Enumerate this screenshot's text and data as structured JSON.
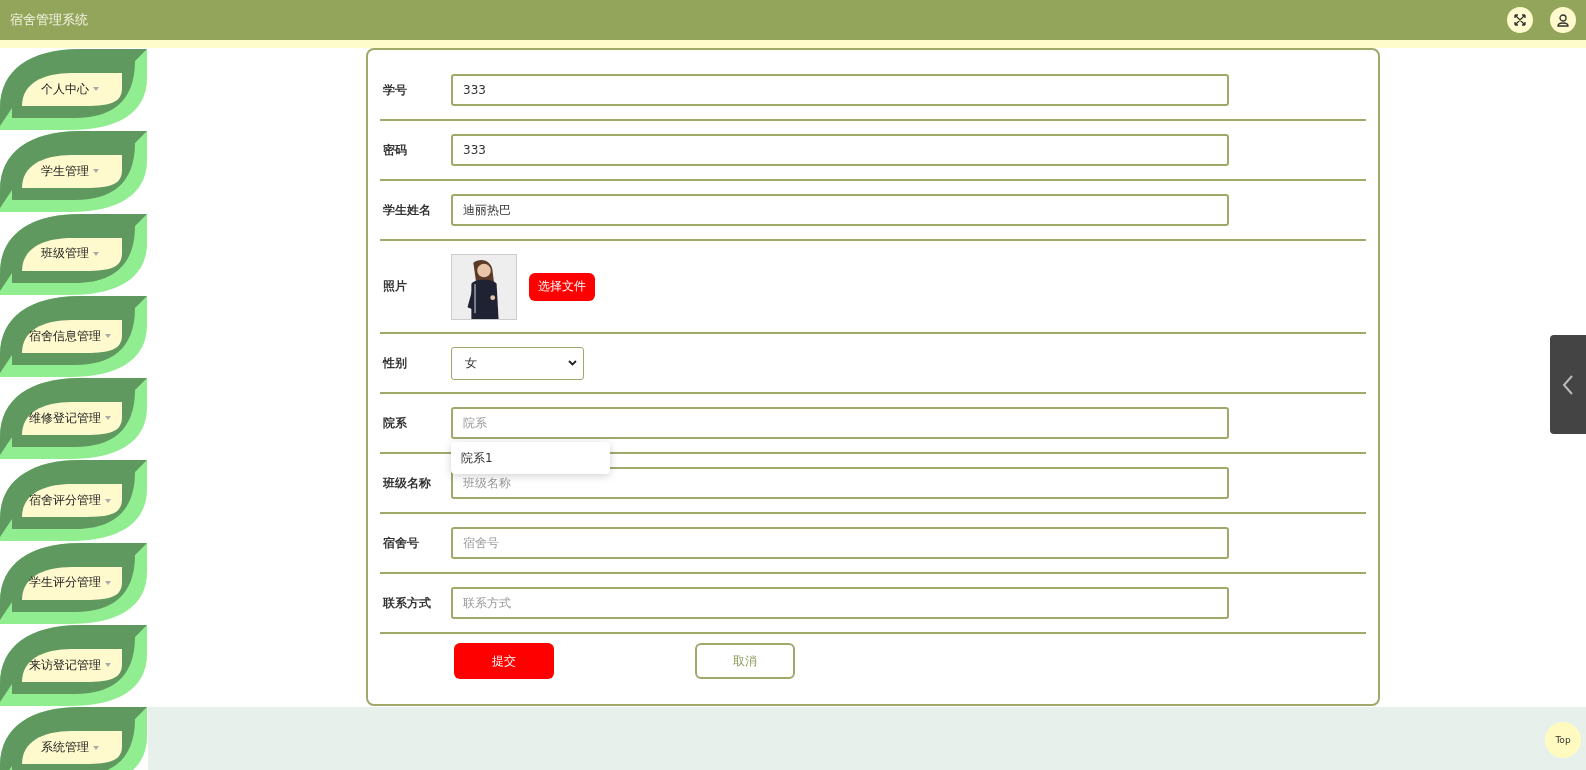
{
  "header": {
    "title": "宿舍管理系统"
  },
  "sidebar": {
    "items": [
      {
        "label": "个人中心"
      },
      {
        "label": "学生管理"
      },
      {
        "label": "班级管理"
      },
      {
        "label": "宿舍信息管理"
      },
      {
        "label": "维修登记管理"
      },
      {
        "label": "宿舍评分管理"
      },
      {
        "label": "学生评分管理"
      },
      {
        "label": "来访登记管理"
      },
      {
        "label": "系统管理"
      }
    ]
  },
  "form": {
    "fields": [
      {
        "kind": "text",
        "label": "学号",
        "value": "333"
      },
      {
        "kind": "text",
        "label": "密码",
        "value": "333"
      },
      {
        "kind": "text",
        "label": "学生姓名",
        "value": "迪丽热巴"
      },
      {
        "label": "照片",
        "button": "选择文件"
      },
      {
        "kind": "select",
        "label": "性别",
        "value": "女"
      },
      {
        "kind": "text",
        "label": "院系",
        "placeholder": "院系",
        "suggestions": [
          "院系1"
        ]
      },
      {
        "kind": "text",
        "label": "班级名称",
        "placeholder": "班级名称"
      },
      {
        "kind": "text",
        "label": "宿舍号",
        "placeholder": "宿舍号"
      },
      {
        "kind": "text",
        "label": "联系方式",
        "placeholder": "联系方式"
      }
    ],
    "buttons": [
      {
        "kind": "primary",
        "label": "提交"
      },
      {
        "kind": "secondary",
        "label": "取消"
      }
    ]
  },
  "top_button": {
    "label": "Top"
  }
}
